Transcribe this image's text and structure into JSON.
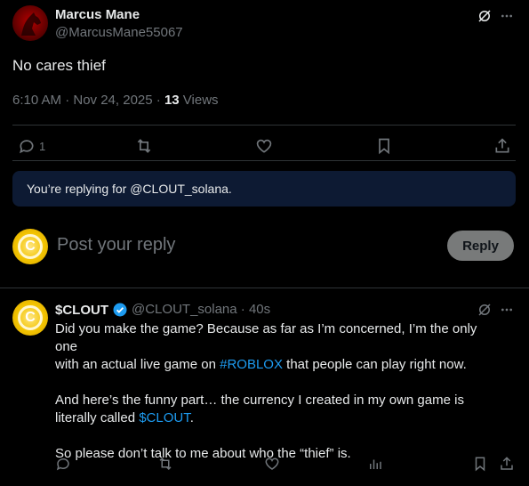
{
  "post": {
    "name": "Marcus Mane",
    "handle": "@MarcusMane55067",
    "text": "No cares thief",
    "time": "6:10 AM · Nov 24, 2025 · ",
    "views_count": "13",
    "views_label": " Views",
    "reply_count": "1"
  },
  "reply_banner": {
    "text": "You’re replying for @CLOUT_solana."
  },
  "composer": {
    "placeholder": "Post your reply",
    "button_label": "Reply"
  },
  "reply": {
    "name": "$CLOUT",
    "handle_time": "@CLOUT_solana · 40s",
    "line1": "Did you make the game? Because as far as I’m concerned, I’m the only one",
    "line2_a": "with an actual live game on ",
    "line2_link": "#ROBLOX",
    "line2_b": " that people can play right now.",
    "line3": "And here’s the funny part… the currency I created in my own game is",
    "line4_a": "literally called ",
    "line4_link": "$CLOUT",
    "line4_b": ".",
    "line5": "So please don’t talk to me about who the “thief” is."
  },
  "colors": {
    "link": "#1d9bf0",
    "verified": "#1d9bf0",
    "banner_bg": "#0d1a33",
    "reply_button_bg": "#787a7a"
  }
}
